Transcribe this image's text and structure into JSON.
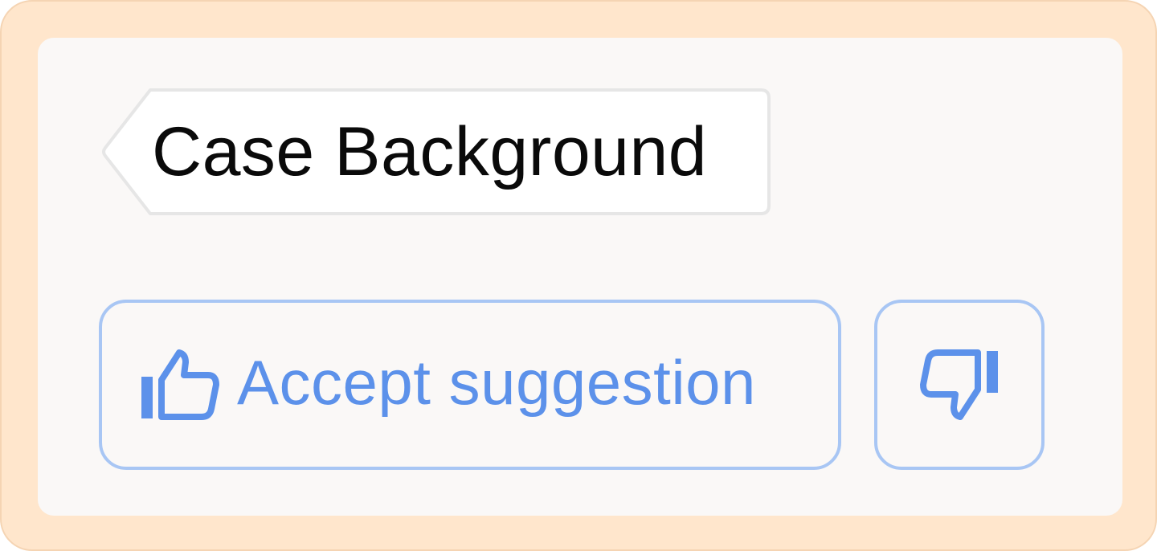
{
  "tag": {
    "label": "Case Background"
  },
  "actions": {
    "accept_label": "Accept suggestion",
    "accept_icon": "thumbs-up-icon",
    "reject_icon": "thumbs-down-icon"
  },
  "colors": {
    "frame_background": "#ffe6cc",
    "card_background": "#faf8f7",
    "accent": "#5c91ea",
    "button_border": "#a8c6f4",
    "tag_border": "#e6e6e6"
  }
}
